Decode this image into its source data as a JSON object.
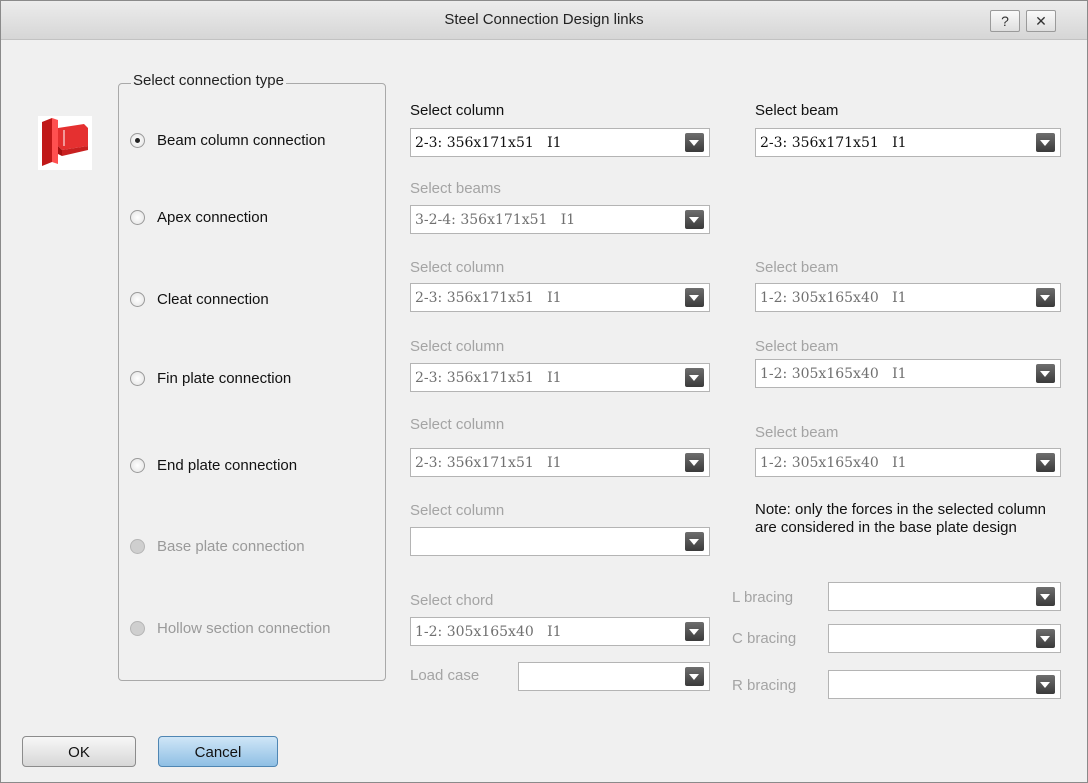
{
  "window": {
    "title": "Steel Connection Design links",
    "help_label": "?",
    "close_label": "✕"
  },
  "group": {
    "legend": "Select connection type",
    "options": [
      {
        "label": "Beam column connection",
        "checked": true,
        "enabled": true
      },
      {
        "label": "Apex connection",
        "checked": false,
        "enabled": true
      },
      {
        "label": "Cleat connection",
        "checked": false,
        "enabled": true
      },
      {
        "label": "Fin plate connection",
        "checked": false,
        "enabled": true
      },
      {
        "label": "End plate connection",
        "checked": false,
        "enabled": true
      },
      {
        "label": "Base plate connection",
        "checked": false,
        "enabled": false
      },
      {
        "label": "Hollow section connection",
        "checked": false,
        "enabled": false
      }
    ]
  },
  "beam_column": {
    "col_label": "Select column",
    "col_value": "2-3: 356x171x51   I1",
    "beam_label": "Select beam",
    "beam_value": "2-3: 356x171x51   I1"
  },
  "apex": {
    "beams_label": "Select beams",
    "beams_value": "3-2-4: 356x171x51   I1"
  },
  "cleat": {
    "col_label": "Select column",
    "col_value": "2-3: 356x171x51   I1",
    "beam_label": "Select beam",
    "beam_value": "1-2: 305x165x40   I1"
  },
  "fin_plate": {
    "col_label": "Select column",
    "col_value": "2-3: 356x171x51   I1",
    "beam_label": "Select beam",
    "beam_value": "1-2: 305x165x40   I1"
  },
  "end_plate": {
    "col_label": "Select column",
    "col_value": "2-3: 356x171x51   I1",
    "beam_label": "Select beam",
    "beam_value": "1-2: 305x165x40   I1"
  },
  "base_plate": {
    "col_label": "Select column",
    "col_value": "",
    "note": "Note: only the forces in the selected column are considered in the base plate design"
  },
  "hollow": {
    "chord_label": "Select chord",
    "chord_value": "1-2: 305x165x40   I1",
    "load_case_label": "Load case",
    "load_case_value": "",
    "l_bracing_label": "L bracing",
    "c_bracing_label": "C bracing",
    "r_bracing_label": "R bracing"
  },
  "buttons": {
    "ok": "OK",
    "cancel": "Cancel"
  },
  "icons": {
    "connection": "steel-connection-icon",
    "dropdown": "chevron-down-icon"
  },
  "colors": {
    "accent_blue": "#8fbfe4",
    "icon_red": "#e03030"
  }
}
